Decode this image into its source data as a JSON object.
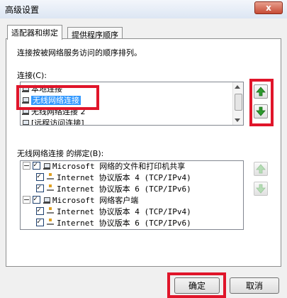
{
  "window": {
    "title": "高级设置",
    "close_glyph": "x"
  },
  "tabs": [
    {
      "label": "适配器和绑定"
    },
    {
      "label": "提供程序顺序"
    }
  ],
  "description": "连接按被网络服务访问的顺序排列。",
  "connections": {
    "label": "连接(C):",
    "items": [
      {
        "label": "本地连接"
      },
      {
        "label": "无线网络连接"
      },
      {
        "label": "无线网络连接 2"
      },
      {
        "label": "[远程访问连接]"
      }
    ],
    "selected_index": 1
  },
  "bindings": {
    "label": "无线网络连接 的绑定(B):",
    "items": [
      {
        "label": "Microsoft 网络的文件和打印机共享",
        "checked": true
      },
      {
        "label": "Internet 协议版本 4 (TCP/IPv4)",
        "checked": true
      },
      {
        "label": "Internet 协议版本 6 (TCP/IPv6)",
        "checked": true
      },
      {
        "label": "Microsoft 网络客户端",
        "checked": true
      },
      {
        "label": "Internet 协议版本 4 (TCP/IPv4)",
        "checked": true
      },
      {
        "label": "Internet 协议版本 6 (TCP/IPv6)",
        "checked": true
      }
    ]
  },
  "buttons": {
    "ok": "确定",
    "cancel": "取消"
  },
  "colors": {
    "highlight": "#e0152a",
    "selection": "#3399ff",
    "arrow_green": "#2e9a2e"
  }
}
